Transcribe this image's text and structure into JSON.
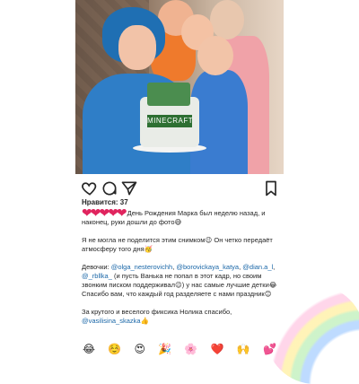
{
  "post": {
    "likes_text": "Нравится: 37",
    "caption": {
      "line1_hearts": "❤❤❤❤❤",
      "line1": "День Рождения Марка был неделю назад, и наконец, руки дошли до фото😅",
      "line2": "Я не могла не поделится этим снимком😉 Он четко передаёт атмосферу того дня🥳",
      "line3_prefix": "Девочки: ",
      "line3_tag1": "@olga_nesterovichh",
      "line3_sep1": ", ",
      "line3_tag2": "@borovickaya_katya",
      "line3_sep2": ", ",
      "line3_tag3": "@dian.a_l",
      "line3_sep3": ", ",
      "line3_tag4": "@_rbllka_",
      "line3_rest": " (и пусть Ванька не попал в этот кадр, но своим звонким писком поддерживал😉) у нас самые лучшие детки😂",
      "line4": "Спасибо вам, что каждый год разделяете с нами праздник😊",
      "line5_prefix": "За крутого и веселого фиксика Нолика спасибо, ",
      "line5_tag": "@vasilisina_skazka",
      "line5_suffix": "👍"
    },
    "photo_cake_text": "MINECRAFT"
  },
  "emoji_bar": [
    "😂",
    "☺️",
    "😍",
    "🎉",
    "🌸",
    "❤️",
    "🙌",
    "💕"
  ],
  "icons": [
    "heart-icon",
    "comment-icon",
    "share-icon",
    "bookmark-icon"
  ]
}
